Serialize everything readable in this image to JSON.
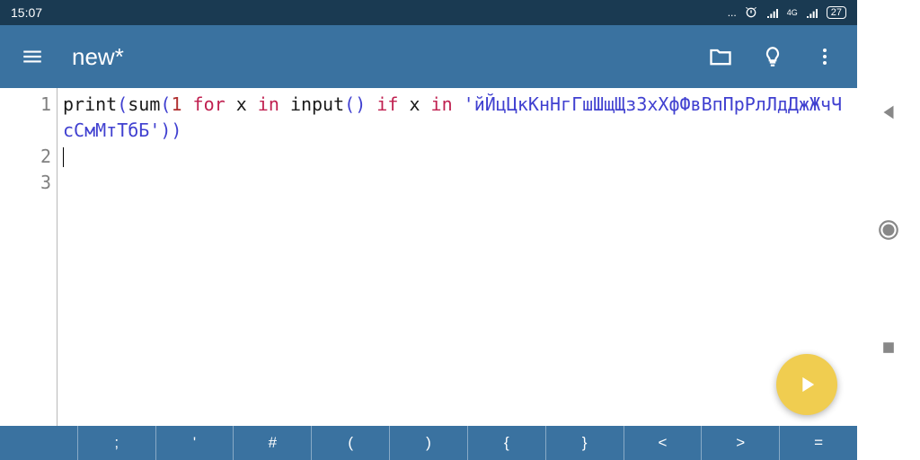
{
  "status": {
    "time": "15:07",
    "dots": "...",
    "network_label": "4G",
    "battery": "27"
  },
  "appbar": {
    "title": "new*"
  },
  "editor": {
    "line_numbers": [
      "1",
      "2",
      "3"
    ],
    "code_tokens": {
      "print": "print",
      "sum": "sum",
      "lp1": "(",
      "lp2": "(",
      "one": "1",
      "sp1": " ",
      "for": "for",
      "sp2": " ",
      "x1": "x",
      "sp3": " ",
      "in1": "in",
      "sp4": " ",
      "input": "input",
      "lp3": "(",
      "rp3": ")",
      "sp5": " ",
      "if": "if",
      "sp6": " ",
      "x2": "x",
      "sp7": " ",
      "in2": "in",
      "nl": " ",
      "str": "'йЙцЦкКнНгГшШщЩзЗхХфФвВпПрРлЛдДжЖчЧсСмМтТбБ'",
      "rp2": ")",
      "rp1": ")"
    }
  },
  "keys": {
    "tab": "",
    "k0": ";",
    "k1": "'",
    "k2": "#",
    "k3": "(",
    "k4": ")",
    "k5": "{",
    "k6": "}",
    "k7": "<",
    "k8": ">",
    "k9": "="
  }
}
